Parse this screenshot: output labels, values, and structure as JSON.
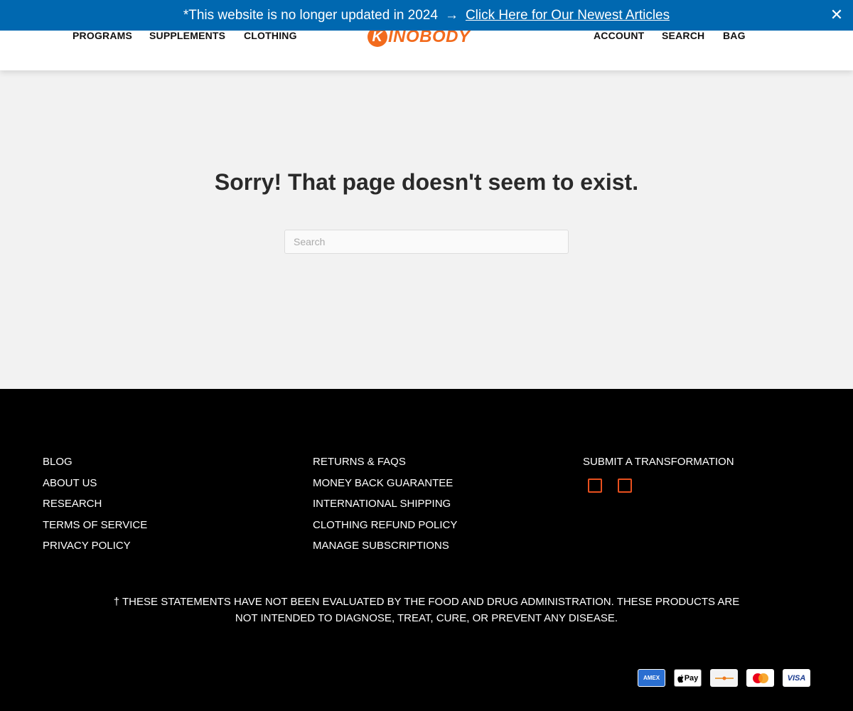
{
  "announcement": {
    "message": "*This website is no longer updated in 2024",
    "arrow": "→",
    "link_text": "Click Here for Our Newest Articles",
    "close": "✕"
  },
  "header": {
    "nav_left": [
      "PROGRAMS",
      "SUPPLEMENTS",
      "CLOTHING"
    ],
    "logo_text": "KINOBODY",
    "nav_right": [
      "ACCOUNT",
      "SEARCH",
      "BAG"
    ]
  },
  "main": {
    "title": "Sorry! That page doesn't seem to exist.",
    "search_placeholder": "Search"
  },
  "footer": {
    "col1": [
      "BLOG",
      "ABOUT US",
      "RESEARCH",
      "TERMS OF SERVICE",
      "PRIVACY POLICY"
    ],
    "col2": [
      "RETURNS & FAQS",
      "MONEY BACK GUARANTEE",
      "INTERNATIONAL SHIPPING",
      "CLOTHING REFUND POLICY",
      "MANAGE SUBSCRIPTIONS"
    ],
    "col3": [
      "SUBMIT A TRANSFORMATION"
    ],
    "social_icons": [
      "facebook-icon",
      "instagram-icon"
    ],
    "disclaimer_line1": "† THESE STATEMENTS HAVE NOT BEEN EVALUATED BY THE FOOD AND DRUG ADMINISTRATION. THESE PRODUCTS ARE",
    "disclaimer_line2": "NOT INTENDED TO DIAGNOSE, TREAT, CURE, OR PREVENT ANY DISEASE.",
    "payments": {
      "amex": "AMEX",
      "apple": "Pay",
      "visa": "VISA"
    }
  },
  "colors": {
    "announcement_bg": "#0068b0",
    "brand_orange": "#f26b1d",
    "social_red": "#e8501e",
    "footer_bg": "#000000",
    "page_bg": "#f2f2f2"
  }
}
